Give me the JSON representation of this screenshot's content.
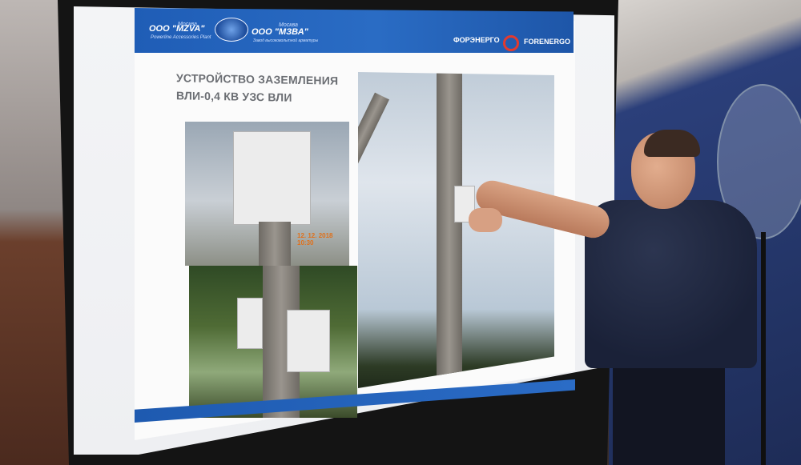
{
  "slide": {
    "company_left_top": "Москва",
    "company_left_name": "ООО \"MZVA\"",
    "company_left_sub": "Powerline Accessories Plant",
    "company_mid_top": "Москва",
    "company_mid_name": "ООО \"МЗВА\"",
    "company_mid_sub": "Завод высоковольтной арматуры",
    "brand_ru": "ФОРЭНЕРГО",
    "brand_en": "FORENERGO",
    "title_line1": "УСТРОЙСТВО ЗАЗЕМЛЕНИЯ",
    "title_line2": "ВЛИ-0,4 КВ УЗС ВЛИ",
    "photo_timestamp": "12. 12. 2018 10:30"
  },
  "colors": {
    "header_blue": "#2363b8",
    "brand_red": "#e23a2f",
    "wall_blue": "#243669"
  },
  "icons": [
    "globe-logo-icon",
    "forenergo-rings-icon"
  ]
}
